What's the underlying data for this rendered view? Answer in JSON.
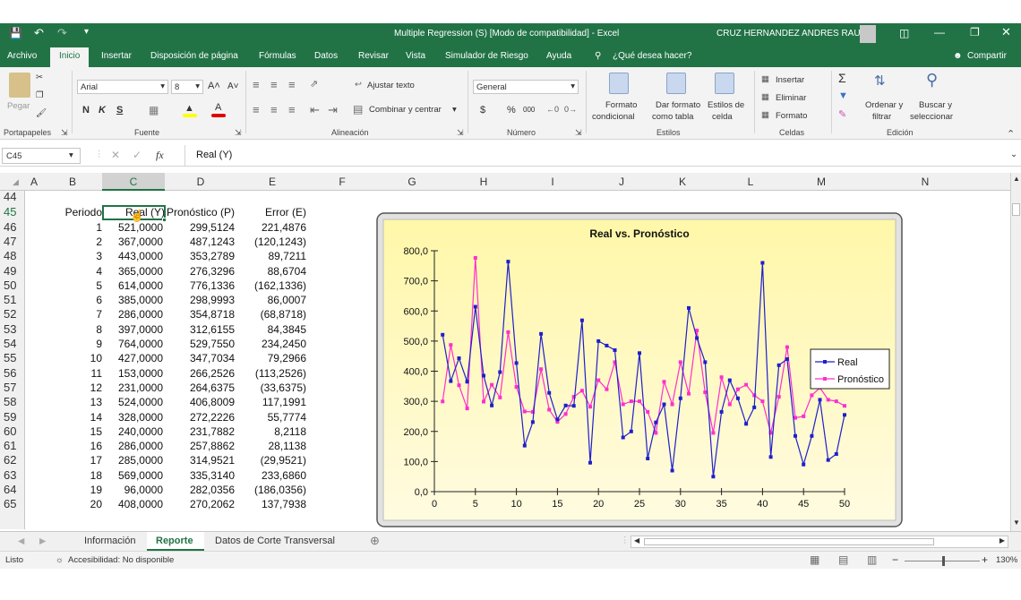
{
  "title": "Multiple Regression (S)  [Modo de compatibilidad]  -  Excel",
  "user": "CRUZ HERNANDEZ ANDRES RAUL",
  "tabs": [
    "Archivo",
    "Inicio",
    "Insertar",
    "Disposición de página",
    "Fórmulas",
    "Datos",
    "Revisar",
    "Vista",
    "Simulador de Riesgo",
    "Ayuda"
  ],
  "tell_me": "¿Qué desea hacer?",
  "share": "Compartir",
  "ribbon": {
    "clipboard": {
      "paste": "Pegar",
      "group": "Portapapeles"
    },
    "font": {
      "name": "Arial",
      "size": "8",
      "bold": "N",
      "italic": "K",
      "underline": "S",
      "group": "Fuente"
    },
    "alignment": {
      "wrap": "Ajustar texto",
      "merge": "Combinar y centrar",
      "group": "Alineación"
    },
    "number": {
      "format": "General",
      "currency": "$",
      "percent": "%",
      "thousands": "000",
      "group": "Número"
    },
    "styles": {
      "conditional_1": "Formato",
      "conditional_2": "condicional",
      "table_1": "Dar formato",
      "table_2": "como tabla",
      "cell_1": "Estilos de",
      "cell_2": "celda",
      "group": "Estilos"
    },
    "cells": {
      "insert": "Insertar",
      "delete": "Eliminar",
      "format": "Formato",
      "group": "Celdas"
    },
    "editing": {
      "sort_1": "Ordenar y",
      "sort_2": "filtrar",
      "find_1": "Buscar y",
      "find_2": "seleccionar",
      "group": "Edición"
    }
  },
  "formula_bar": {
    "name_box": "C45",
    "fx": "fx",
    "content": "Real (Y)"
  },
  "columns": [
    "A",
    "B",
    "C",
    "D",
    "E",
    "F",
    "G",
    "H",
    "I",
    "J",
    "K",
    "L",
    "M",
    "N"
  ],
  "row_numbers": [
    "44",
    "45",
    "46",
    "47",
    "48",
    "49",
    "50",
    "51",
    "52",
    "53",
    "54",
    "55",
    "56",
    "57",
    "58",
    "59",
    "60",
    "61",
    "62",
    "63",
    "64",
    "65"
  ],
  "table": {
    "headers": [
      "Periodo",
      "Real (Y)",
      "Pronóstico (P)",
      "Error (E)"
    ],
    "rows": [
      [
        "1",
        "521,0000",
        "299,5124",
        "221,4876"
      ],
      [
        "2",
        "367,0000",
        "487,1243",
        "(120,1243)"
      ],
      [
        "3",
        "443,0000",
        "353,2789",
        "89,7211"
      ],
      [
        "4",
        "365,0000",
        "276,3296",
        "88,6704"
      ],
      [
        "5",
        "614,0000",
        "776,1336",
        "(162,1336)"
      ],
      [
        "6",
        "385,0000",
        "298,9993",
        "86,0007"
      ],
      [
        "7",
        "286,0000",
        "354,8718",
        "(68,8718)"
      ],
      [
        "8",
        "397,0000",
        "312,6155",
        "84,3845"
      ],
      [
        "9",
        "764,0000",
        "529,7550",
        "234,2450"
      ],
      [
        "10",
        "427,0000",
        "347,7034",
        "79,2966"
      ],
      [
        "11",
        "153,0000",
        "266,2526",
        "(113,2526)"
      ],
      [
        "12",
        "231,0000",
        "264,6375",
        "(33,6375)"
      ],
      [
        "13",
        "524,0000",
        "406,8009",
        "117,1991"
      ],
      [
        "14",
        "328,0000",
        "272,2226",
        "55,7774"
      ],
      [
        "15",
        "240,0000",
        "231,7882",
        "8,2118"
      ],
      [
        "16",
        "286,0000",
        "257,8862",
        "28,1138"
      ],
      [
        "17",
        "285,0000",
        "314,9521",
        "(29,9521)"
      ],
      [
        "18",
        "569,0000",
        "335,3140",
        "233,6860"
      ],
      [
        "19",
        "96,0000",
        "282,0356",
        "(186,0356)"
      ],
      [
        "20",
        "408,0000",
        "270,2062",
        "137,7938"
      ]
    ]
  },
  "chart_data": {
    "type": "line",
    "title": "Real vs. Pronóstico",
    "xlim": [
      0,
      50
    ],
    "ylim": [
      0,
      800
    ],
    "xticks": [
      "0",
      "5",
      "10",
      "15",
      "20",
      "25",
      "30",
      "35",
      "40",
      "45",
      "50"
    ],
    "yticks": [
      "0,0",
      "100,0",
      "200,0",
      "300,0",
      "400,0",
      "500,0",
      "600,0",
      "700,0",
      "800,0"
    ],
    "grid": false,
    "legend_position": "right",
    "series": [
      {
        "name": "Real",
        "color": "#1f1fcc",
        "values": [
          521,
          367,
          443,
          365,
          614,
          385,
          286,
          397,
          764,
          427,
          153,
          231,
          524,
          328,
          240,
          286,
          285,
          569,
          96,
          500,
          485,
          470,
          180,
          200,
          460,
          110,
          230,
          290,
          70,
          310,
          610,
          510,
          430,
          50,
          265,
          370,
          310,
          225,
          280,
          760,
          115,
          420,
          440,
          185,
          90,
          185,
          305,
          105,
          125,
          255
        ]
      },
      {
        "name": "Pronóstico",
        "color": "#ff2ed0",
        "values": [
          299.5124,
          487.1243,
          353.2789,
          276.3296,
          776.1336,
          298.9993,
          354.8718,
          312.6155,
          529.755,
          347.7034,
          266.2526,
          264.6375,
          406.8009,
          272.2226,
          231.7882,
          257.8862,
          314.9521,
          335.314,
          282.0356,
          370,
          340,
          430,
          290,
          300,
          300,
          265,
          195,
          365,
          290,
          430,
          325,
          535,
          330,
          195,
          380,
          290,
          340,
          355,
          320,
          300,
          195,
          315,
          480,
          245,
          250,
          320,
          345,
          305,
          300,
          285
        ]
      }
    ]
  },
  "sheet_tabs": [
    "Información",
    "Reporte",
    "Datos de Corte Transversal"
  ],
  "status": {
    "ready": "Listo",
    "accessibility": "Accesibilidad: No disponible",
    "zoom": "130%"
  },
  "colors": {
    "excel_green": "#217346",
    "chart_bg": "#fff8b0",
    "real": "#1f1fcc",
    "forecast": "#ff2ed0"
  }
}
